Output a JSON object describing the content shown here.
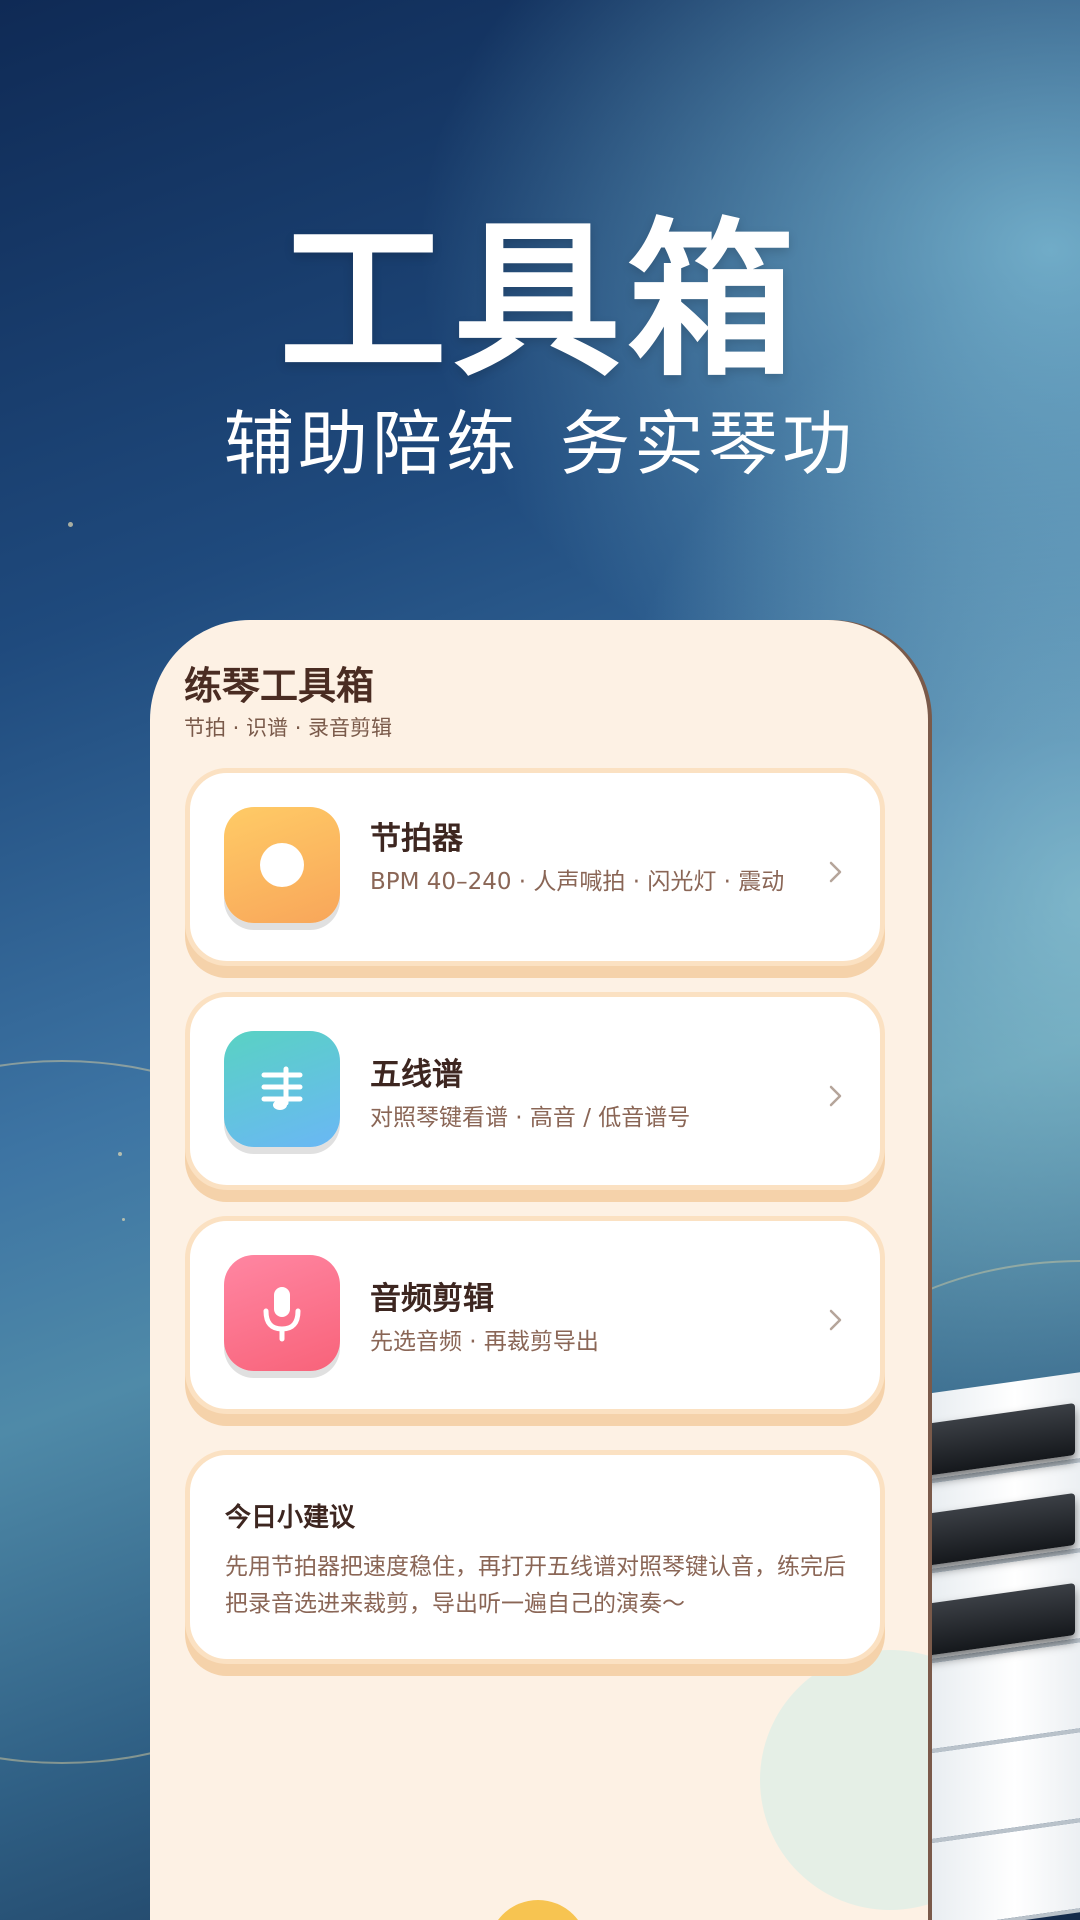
{
  "headline": {
    "title": "工具箱",
    "sub_left": "辅助陪练",
    "sub_right": "务实琴功"
  },
  "app": {
    "title": "练琴工具箱",
    "subtitle": "节拍 · 识谱 · 录音剪辑",
    "tools": [
      {
        "name": "节拍器",
        "desc": "BPM 40–240 · 人声喊拍 · 闪光灯 · 震动",
        "icon": "metronome-icon"
      },
      {
        "name": "五线谱",
        "desc": "对照琴键看谱 · 高音 / 低音谱号",
        "icon": "music-staff-icon"
      },
      {
        "name": "音频剪辑",
        "desc": "先选音频 · 再裁剪导出",
        "icon": "microphone-icon"
      }
    ],
    "tip": {
      "title": "今日小建议",
      "text": "先用节拍器把速度稳住，再打开五线谱对照琴键认音，练完后把录音选进来裁剪，导出听一遍自己的演奏～"
    }
  },
  "colors": {
    "phone_background": "#fdf1e4",
    "card_border": "#fbe1c2",
    "metronome_gradient": [
      "#ffcb66",
      "#f8a65a"
    ],
    "staff_gradient": [
      "#59d2c3",
      "#6ab7f5"
    ],
    "audio_gradient": [
      "#ff86a2",
      "#f8637a"
    ],
    "title_text": "#4a2c22",
    "desc_text": "#8a6656"
  }
}
